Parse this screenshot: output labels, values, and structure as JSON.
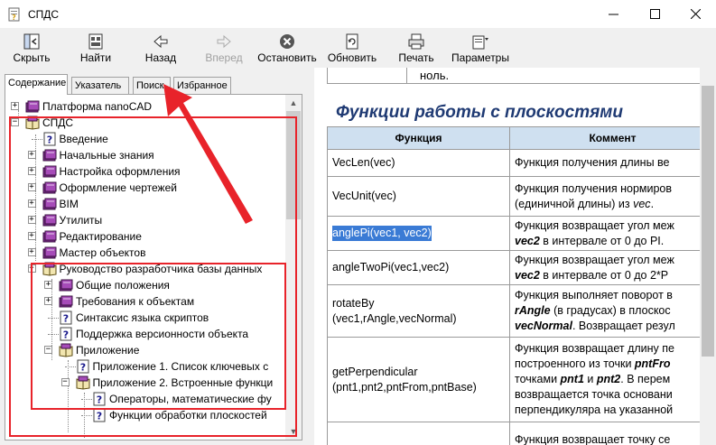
{
  "window": {
    "title": "СПДС"
  },
  "toolbar": [
    {
      "label": "Скрыть",
      "icon": "hide-panel-icon",
      "enabled": true
    },
    {
      "label": "Найти",
      "icon": "find-icon",
      "enabled": true
    },
    {
      "label": "Назад",
      "icon": "back-arrow-icon",
      "enabled": true
    },
    {
      "label": "Вперед",
      "icon": "forward-arrow-icon",
      "enabled": false
    },
    {
      "label": "Остановить",
      "icon": "stop-icon",
      "enabled": true
    },
    {
      "label": "Обновить",
      "icon": "refresh-icon",
      "enabled": true
    },
    {
      "label": "Печать",
      "icon": "print-icon",
      "enabled": true
    },
    {
      "label": "Параметры",
      "icon": "options-icon",
      "enabled": true
    }
  ],
  "tabs": [
    {
      "label": "Содержание",
      "active": true
    },
    {
      "label": "Указатель",
      "active": false
    },
    {
      "label": "Поиск",
      "active": false
    },
    {
      "label": "Избранное",
      "active": false
    }
  ],
  "tree": [
    {
      "label": "Платформа nanoCAD",
      "icon": "book-icon"
    },
    {
      "label": "СПДС",
      "icon": "open-book-icon"
    },
    {
      "label": "Введение",
      "icon": "help-page-icon"
    },
    {
      "label": "Начальные знания",
      "icon": "book-icon"
    },
    {
      "label": "Настройка оформления",
      "icon": "book-icon"
    },
    {
      "label": "Оформление чертежей",
      "icon": "book-icon"
    },
    {
      "label": "BIM",
      "icon": "book-icon"
    },
    {
      "label": "Утилиты",
      "icon": "book-icon"
    },
    {
      "label": "Редактирование",
      "icon": "book-icon"
    },
    {
      "label": "Мастер объектов",
      "icon": "book-icon"
    },
    {
      "label": "Руководство разработчика базы данных",
      "icon": "open-book-icon"
    },
    {
      "label": "Общие положения",
      "icon": "book-icon"
    },
    {
      "label": "Требования к объектам",
      "icon": "book-icon"
    },
    {
      "label": "Синтаксис языка скриптов",
      "icon": "help-page-icon"
    },
    {
      "label": "Поддержка версионности объекта",
      "icon": "help-page-icon"
    },
    {
      "label": "Приложение",
      "icon": "open-book-icon"
    },
    {
      "label": "Приложение 1. Список ключевых с",
      "icon": "help-page-icon"
    },
    {
      "label": "Приложение 2. Встроенные функци",
      "icon": "open-book-icon"
    },
    {
      "label": "Операторы, математические фу",
      "icon": "help-page-icon"
    },
    {
      "label": "Функции обработки плоскостей",
      "icon": "help-page-icon"
    }
  ],
  "doc": {
    "top_cell": "ноль.",
    "heading": "Функции работы с плоскостями",
    "columns": [
      "Функция",
      "Коммент"
    ],
    "rows": [
      {
        "fn": [
          "VecLen(vec)"
        ],
        "desc": [
          "Функция получения длины ве"
        ]
      },
      {
        "fn": [
          "VecUnit(vec)"
        ],
        "desc": [
          "Функция получения нормиров",
          "(единичной длины) из vec."
        ]
      },
      {
        "fn": [
          "anglePi(vec1, vec2)"
        ],
        "desc": [
          "Функция возвращает угол меж",
          "vec2 в интервале от 0 до PI."
        ],
        "highlight": true
      },
      {
        "fn": [
          "angleTwoPi(vec1,vec2)"
        ],
        "desc": [
          "Функция возвращает угол меж",
          "vec2 в интервале от  0 до 2*P"
        ]
      },
      {
        "fn": [
          "rotateBy",
          "(vec1,rAngle,vecNormal)"
        ],
        "desc": [
          "Функция выполняет поворот в",
          "rAngle (в градусах) в плоскос",
          "vecNormal. Возвращает резул"
        ]
      },
      {
        "fn": [
          "getPerpendicular",
          "(pnt1,pnt2,pntFrom,pntBase)"
        ],
        "desc": [
          "Функция возвращает длину пе",
          "построенного из точки pntFro",
          "точками pnt1 и pnt2. В перем",
          "возвращается точка основани",
          "перпендикуляра на указанной"
        ]
      },
      {
        "fn": [
          ""
        ],
        "desc": [
          "Функция возвращает точку се"
        ]
      }
    ]
  }
}
